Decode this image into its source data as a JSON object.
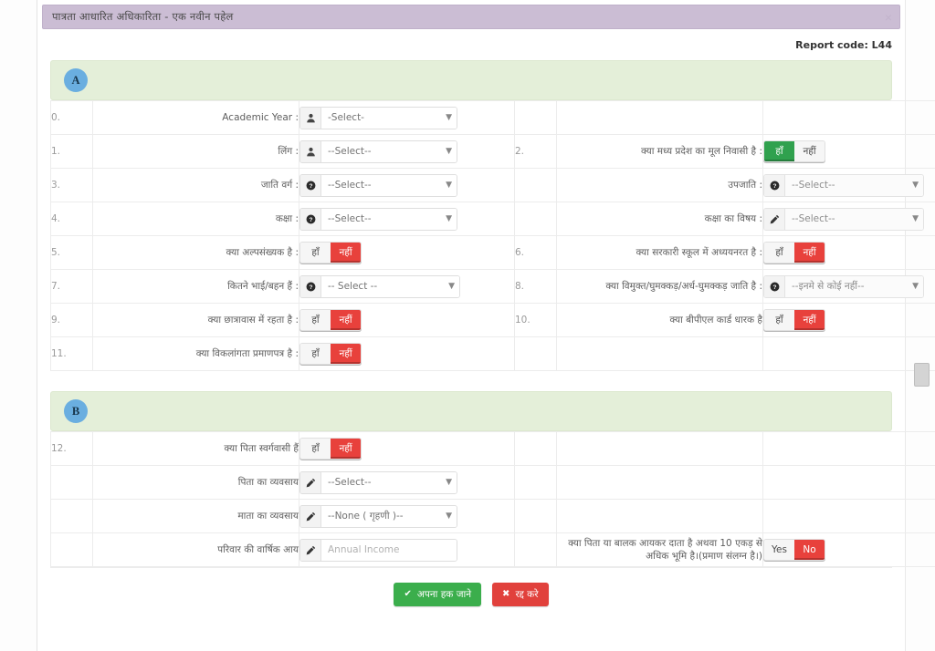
{
  "window": {
    "title": "पात्रता आधारित अधिकारिता - एक नवीन पहेल",
    "close_label": "×"
  },
  "report": {
    "code_label": "Report code: L44"
  },
  "colors": {
    "title_bar": "#cbbdd4",
    "section_band": "#e4efd9",
    "badge": "#6aaee0",
    "toggle_yes": "#30a14e",
    "toggle_no": "#e8413c",
    "btn_submit": "#3bae4c",
    "btn_cancel": "#e1413c"
  },
  "sections": [
    {
      "badge": "A",
      "rows": [
        {
          "left": {
            "num": "0.",
            "label": "Academic Year :",
            "control": "select",
            "icon": "user-icon",
            "value": "-Select-",
            "width": "narrow"
          },
          "right": null
        },
        {
          "left": {
            "num": "1.",
            "label": "लिंग :",
            "control": "select",
            "icon": "user-icon",
            "value": "--Select--",
            "width": "narrow"
          },
          "right": {
            "num": "2.",
            "label": "क्या मध्य प्रदेश का मूल निवासी है :",
            "control": "toggle",
            "options": [
              "हाँ",
              "नहीं"
            ],
            "selected": "हाँ",
            "state": "yes"
          }
        },
        {
          "left": {
            "num": "3.",
            "label": "जाति वर्ग :",
            "control": "select",
            "icon": "question-icon",
            "value": "--Select--",
            "width": "narrow"
          },
          "right": {
            "num": "",
            "label": "उपजाति :",
            "control": "select",
            "icon": "question-icon",
            "value": "--Select--",
            "width": "wide",
            "muted": true
          }
        },
        {
          "left": {
            "num": "4.",
            "label": "कक्षा :",
            "control": "select",
            "icon": "question-icon",
            "value": "--Select--",
            "width": "narrow"
          },
          "right": {
            "num": "",
            "label": "कक्षा का विषय :",
            "control": "select",
            "icon": "pencil-icon",
            "value": "--Select--",
            "width": "wide",
            "muted": true
          }
        },
        {
          "left": {
            "num": "5.",
            "label": "क्या अल्पसंख्यक है :",
            "control": "toggle",
            "options": [
              "हाँ",
              "नहीं"
            ],
            "selected": "नहीं",
            "state": "no"
          },
          "right": {
            "num": "6.",
            "label": "क्या सरकारी स्कूल में अध्ययनरत है :",
            "control": "toggle",
            "options": [
              "हाँ",
              "नहीं"
            ],
            "selected": "नहीं",
            "state": "no"
          }
        },
        {
          "left": {
            "num": "7.",
            "label": "कितने भाई/बहन हैं :",
            "control": "select",
            "icon": "question-icon",
            "value": "-- Select --",
            "width": "wide"
          },
          "right": {
            "num": "8.",
            "label": "क्या विमुक्त/घुमक्कड़/अर्ध-घुमक्कड़ जाति है :",
            "control": "select",
            "icon": "question-icon",
            "value": "--इनमे से कोई नहीं--",
            "width": "wide",
            "muted": true
          }
        },
        {
          "left": {
            "num": "9.",
            "label": "क्या छात्रावास में रहता है :",
            "control": "toggle",
            "options": [
              "हाँ",
              "नहीं"
            ],
            "selected": "नहीं",
            "state": "no"
          },
          "right": {
            "num": "10.",
            "label": "क्या बीपीएल कार्ड धारक है",
            "control": "toggle",
            "options": [
              "हाँ",
              "नहीं"
            ],
            "selected": "नहीं",
            "state": "no"
          }
        },
        {
          "left": {
            "num": "11.",
            "label": "क्या विकलांगता प्रमाणपत्र है :",
            "control": "toggle",
            "options": [
              "हाँ",
              "नहीं"
            ],
            "selected": "नहीं",
            "state": "no"
          },
          "right": null
        }
      ]
    },
    {
      "badge": "B",
      "rows": [
        {
          "left": {
            "num": "12.",
            "label": "क्या पिता स्वर्गवासी हैं",
            "control": "toggle",
            "options": [
              "हाँ",
              "नहीं"
            ],
            "selected": "नहीं",
            "state": "no"
          },
          "right": null
        },
        {
          "left": {
            "num": "",
            "label": "पिता का व्यवसाय",
            "control": "select",
            "icon": "pencil-icon",
            "value": "--Select--",
            "width": "narrow"
          },
          "right": null
        },
        {
          "left": {
            "num": "",
            "label": "माता का व्यवसाय",
            "control": "select",
            "icon": "pencil-icon",
            "value": "--None ( गृहणी )--",
            "width": "narrow"
          },
          "right": null
        },
        {
          "left": {
            "num": "",
            "label": "परिवार की वार्षिक आय",
            "control": "input",
            "icon": "pencil-icon",
            "value": "",
            "placeholder": "Annual Income",
            "width": "narrow"
          },
          "right": {
            "num": "",
            "label": "क्या पिता या बालक आयकर दाता है अथवा 10 एकड़ से अधिक भूमि है।(प्रमाण संलग्न है।)",
            "control": "toggle",
            "options": [
              "Yes",
              "No"
            ],
            "selected": "No",
            "state": "no"
          }
        }
      ]
    }
  ],
  "footer": {
    "submit_label": "अपना हक जाने",
    "submit_icon": "check-icon",
    "cancel_label": "रद्द करे",
    "cancel_icon": "close-x-icon"
  }
}
